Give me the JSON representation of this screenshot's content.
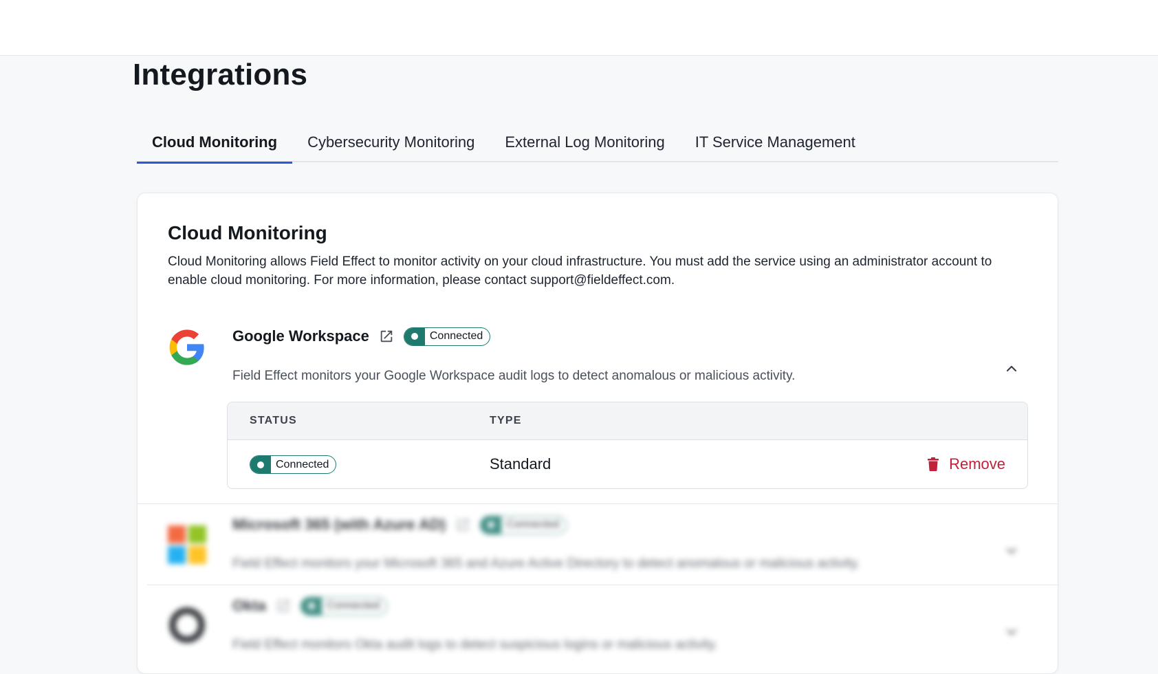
{
  "page": {
    "title": "Integrations"
  },
  "tabs": [
    {
      "label": "Cloud Monitoring",
      "active": true
    },
    {
      "label": "Cybersecurity Monitoring",
      "active": false
    },
    {
      "label": "External Log Monitoring",
      "active": false
    },
    {
      "label": "IT Service Management",
      "active": false
    }
  ],
  "section": {
    "title": "Cloud Monitoring",
    "description": "Cloud Monitoring allows Field Effect to monitor activity on your cloud infrastructure. You must add the service using an administrator account to enable cloud monitoring. For more information, please contact support@fieldeffect.com."
  },
  "integrations": [
    {
      "name": "Google Workspace",
      "badge": "Connected",
      "description": "Field Effect monitors your Google Workspace audit logs to detect anomalous or malicious activity.",
      "expanded": true,
      "icon": "google-logo-icon",
      "details": {
        "status_header": "STATUS",
        "type_header": "TYPE",
        "status_value": "Connected",
        "type_value": "Standard",
        "remove_label": "Remove"
      }
    },
    {
      "name": "Microsoft 365 (with Azure AD)",
      "badge": "Connected",
      "description": "Field Effect monitors your Microsoft 365 and Azure Active Directory to detect anomalous or malicious activity.",
      "expanded": false,
      "icon": "microsoft-logo-icon"
    },
    {
      "name": "Okta",
      "badge": "Connected",
      "description": "Field Effect monitors Okta audit logs to detect suspicious logins or malicious activity.",
      "expanded": false,
      "icon": "okta-logo-icon"
    }
  ],
  "colors": {
    "accent": "#2b5ad8",
    "connected": "#1e7a6e",
    "danger": "#c21f3a"
  }
}
